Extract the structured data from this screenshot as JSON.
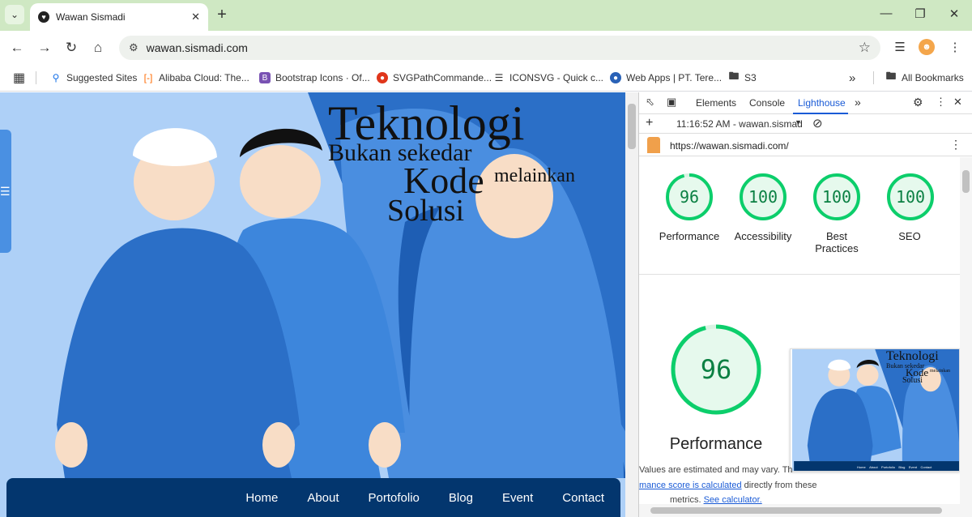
{
  "browser": {
    "tab_title": "Wawan Sismadi",
    "url": "wawan.sismadi.com"
  },
  "bookmarks": [
    {
      "label": "Suggested Sites",
      "icon": "search-icon",
      "color": "#1a73e8"
    },
    {
      "label": "Alibaba Cloud: The...",
      "icon": "alibaba-icon",
      "color": "#ff6a00"
    },
    {
      "label": "Bootstrap Icons · Of...",
      "icon": "bootstrap-icon",
      "color": "#7952b3"
    },
    {
      "label": "SVGPathCommande...",
      "icon": "svgpath-icon",
      "color": "#e0361b"
    },
    {
      "label": "ICONSVG - Quick c...",
      "icon": "layers-icon",
      "color": "#333333"
    },
    {
      "label": "Web Apps | PT. Tere...",
      "icon": "webapps-icon",
      "color": "#2a62b7"
    },
    {
      "label": "S3",
      "icon": "folder-icon",
      "color": "#444444"
    }
  ],
  "all_bookmarks_label": "All Bookmarks",
  "site": {
    "headline": {
      "word1": "Teknologi",
      "word2": "Bukan sekedar",
      "word3": "Kode",
      "word4": "melainkan",
      "word5": "Solusi"
    },
    "nav": [
      "Home",
      "About",
      "Portofolio",
      "Blog",
      "Event",
      "Contact"
    ],
    "colors": {
      "navbar": "#03366e",
      "sky": "#aed0f7",
      "robe_dark": "#2b6fc7",
      "robe_mid": "#4a8ee0",
      "skin": "#f8ddc6"
    }
  },
  "devtools": {
    "tabs": [
      "Elements",
      "Console",
      "Lighthouse"
    ],
    "active_tab": "Lighthouse",
    "report_time": "11:16:52 AM - wawan.sismad",
    "report_url": "https://wawan.sismadi.com/",
    "scores": [
      {
        "label": "Performance",
        "value": 96
      },
      {
        "label": "Accessibility",
        "value": 100
      },
      {
        "label": "Best Practices",
        "value": 100
      },
      {
        "label": "SEO",
        "value": 100
      }
    ],
    "big_score": {
      "label": "Performance",
      "value": 96
    },
    "note_part1": "Values are estimated and may vary. Th",
    "note_link1": "mance score is calculated",
    "note_part2": " directly from these",
    "note_part3": "metrics. ",
    "note_link2": "See calculator.",
    "score_color": "#0cce6b",
    "score_bg": "#e6f9ed"
  }
}
